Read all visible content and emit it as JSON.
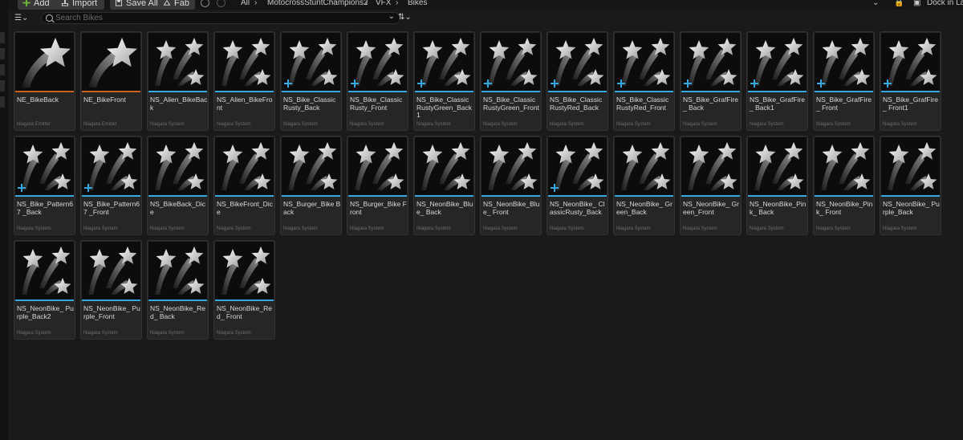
{
  "toolbar": {
    "add_label": "Add",
    "import_label": "Import",
    "save_all_label": "Save All",
    "fab_label": "Fab",
    "dock_label": "Dock in Layout"
  },
  "breadcrumb": [
    "All",
    "MotocrossStuntChampions2",
    "VFX",
    "Bikes"
  ],
  "search": {
    "placeholder": "Search Bikes"
  },
  "colors": {
    "emitter_accent": "#c8621e",
    "system_accent": "#35a8e0",
    "add_icon": "#6dbb3a"
  },
  "assets": [
    {
      "name": "NE_BikeBack",
      "type": "Niagara Emitter",
      "icon": "emitter-star-icon",
      "plus": false
    },
    {
      "name": "NE_BikeFront",
      "type": "Niagara Emitter",
      "icon": "emitter-star-icon",
      "plus": false
    },
    {
      "name": "NS_Alien_BikeBack",
      "type": "Niagara System",
      "icon": "system-stars-icon",
      "plus": false
    },
    {
      "name": "NS_Alien_BikeFront",
      "type": "Niagara System",
      "icon": "system-stars-icon",
      "plus": false
    },
    {
      "name": "NS_Bike_Classic Rusty_Back",
      "type": "Niagara System",
      "icon": "system-stars-icon",
      "plus": true
    },
    {
      "name": "NS_Bike_Classic Rusty_Front",
      "type": "Niagara System",
      "icon": "system-stars-icon",
      "plus": true
    },
    {
      "name": "NS_Bike_Classic RustyGreen_Back1",
      "type": "Niagara System",
      "icon": "system-stars-icon",
      "plus": true
    },
    {
      "name": "NS_Bike_Classic RustyGreen_Front",
      "type": "Niagara System",
      "icon": "system-stars-icon",
      "plus": true
    },
    {
      "name": "NS_Bike_Classic RustyRed_Back",
      "type": "Niagara System",
      "icon": "system-stars-icon",
      "plus": true
    },
    {
      "name": "NS_Bike_Classic RustyRed_Front",
      "type": "Niagara System",
      "icon": "system-stars-icon",
      "plus": true
    },
    {
      "name": "NS_Bike_GrafFire_ Back",
      "type": "Niagara System",
      "icon": "system-stars-icon",
      "plus": true
    },
    {
      "name": "NS_Bike_GrafFire_ Back1",
      "type": "Niagara System",
      "icon": "system-stars-icon",
      "plus": true
    },
    {
      "name": "NS_Bike_GrafFire_ Front",
      "type": "Niagara System",
      "icon": "system-stars-icon",
      "plus": true
    },
    {
      "name": "NS_Bike_GrafFire_ Front1",
      "type": "Niagara System",
      "icon": "system-stars-icon",
      "plus": true
    },
    {
      "name": "NS_Bike_Pattern67 _Back",
      "type": "Niagara System",
      "icon": "system-stars-icon",
      "plus": true
    },
    {
      "name": "NS_Bike_Pattern67 _Front",
      "type": "Niagara System",
      "icon": "system-stars-icon",
      "plus": true
    },
    {
      "name": "NS_BikeBack_Dice",
      "type": "Niagara System",
      "icon": "system-stars-icon",
      "plus": false
    },
    {
      "name": "NS_BikeFront_Dice",
      "type": "Niagara System",
      "icon": "system-stars-icon",
      "plus": false
    },
    {
      "name": "NS_Burger_Bike Back",
      "type": "Niagara System",
      "icon": "system-stars-icon",
      "plus": false
    },
    {
      "name": "NS_Burger_Bike Front",
      "type": "Niagara System",
      "icon": "system-stars-icon",
      "plus": false
    },
    {
      "name": "NS_NeonBike_Blue_ Back",
      "type": "Niagara System",
      "icon": "system-stars-icon",
      "plus": false
    },
    {
      "name": "NS_NeonBike_Blue_ Front",
      "type": "Niagara System",
      "icon": "system-stars-icon",
      "plus": false
    },
    {
      "name": "NS_NeonBike_ ClassicRusty_Back",
      "type": "Niagara System",
      "icon": "system-stars-icon",
      "plus": true
    },
    {
      "name": "NS_NeonBike_ Green_Back",
      "type": "Niagara System",
      "icon": "system-stars-icon",
      "plus": false
    },
    {
      "name": "NS_NeonBike_ Green_Front",
      "type": "Niagara System",
      "icon": "system-stars-icon",
      "plus": false
    },
    {
      "name": "NS_NeonBike_Pink_ Back",
      "type": "Niagara System",
      "icon": "system-stars-icon",
      "plus": false
    },
    {
      "name": "NS_NeonBike_Pink_ Front",
      "type": "Niagara System",
      "icon": "system-stars-icon",
      "plus": false
    },
    {
      "name": "NS_NeonBike_ Purple_Back",
      "type": "Niagara System",
      "icon": "system-stars-icon",
      "plus": false
    },
    {
      "name": "NS_NeonBike_ Purple_Back2",
      "type": "Niagara System",
      "icon": "system-stars-icon",
      "plus": false
    },
    {
      "name": "NS_NeonBike_ Purple_Front",
      "type": "Niagara System",
      "icon": "system-stars-icon",
      "plus": false
    },
    {
      "name": "NS_NeonBike_Red_ Back",
      "type": "Niagara System",
      "icon": "system-stars-icon",
      "plus": false
    },
    {
      "name": "NS_NeonBike_Red_ Front",
      "type": "Niagara System",
      "icon": "system-stars-icon",
      "plus": false
    }
  ]
}
